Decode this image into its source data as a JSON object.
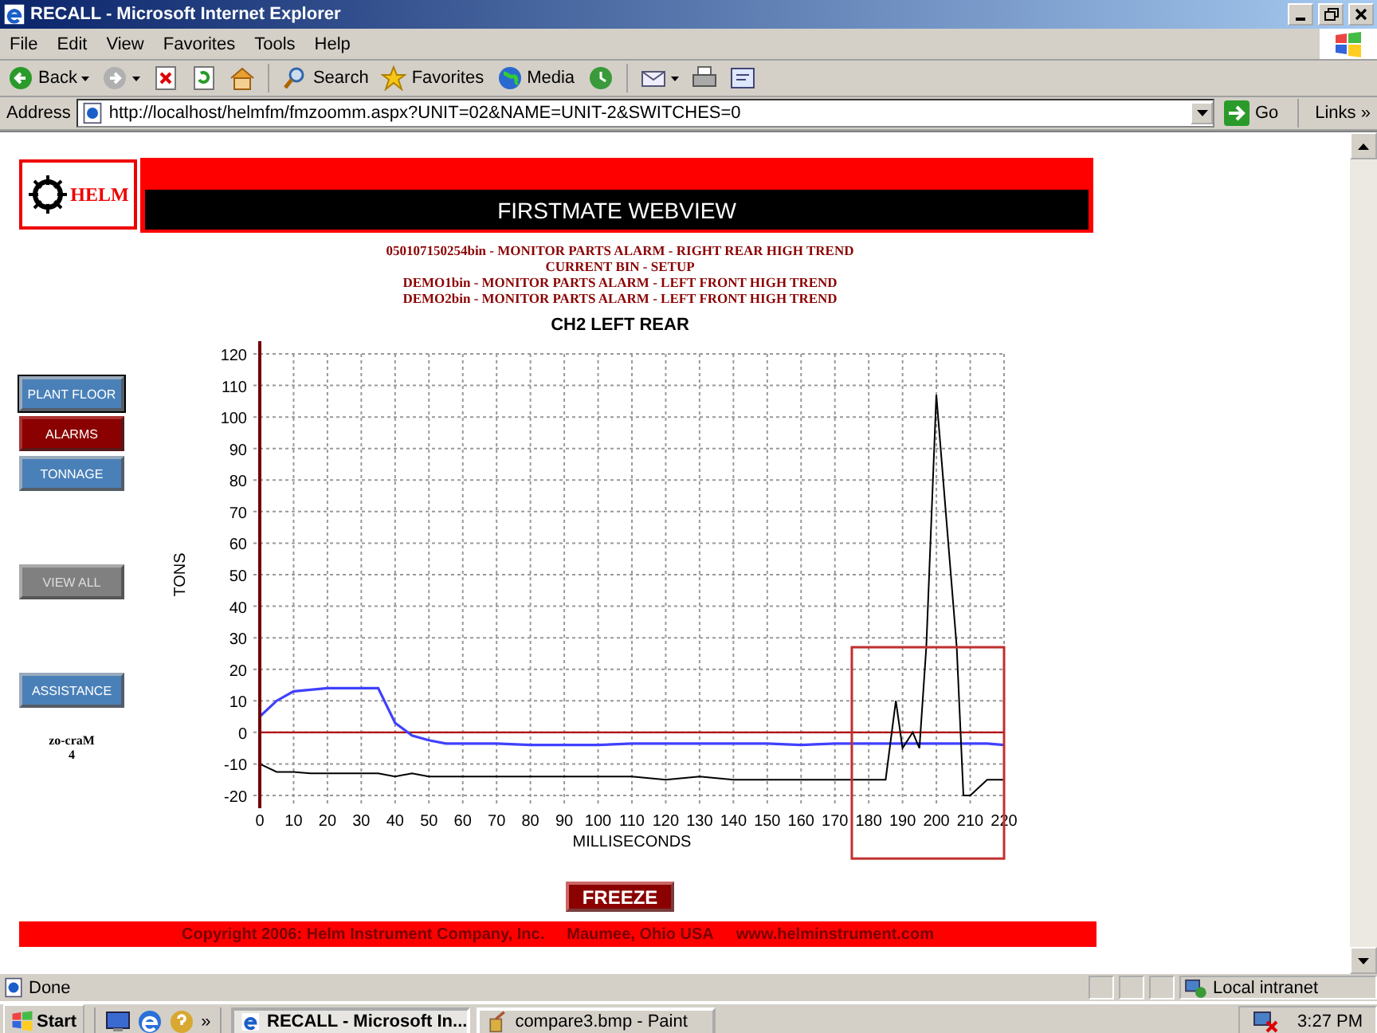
{
  "window": {
    "title": "RECALL - Microsoft Internet Explorer"
  },
  "menu": [
    "File",
    "Edit",
    "View",
    "Favorites",
    "Tools",
    "Help"
  ],
  "toolbar": [
    {
      "kind": "back",
      "label": "Back"
    },
    {
      "kind": "forward"
    },
    {
      "kind": "stop"
    },
    {
      "kind": "refresh"
    },
    {
      "kind": "home"
    },
    {
      "kind": "search",
      "label": "Search"
    },
    {
      "kind": "favorites",
      "label": "Favorites"
    },
    {
      "kind": "media",
      "label": "Media"
    },
    {
      "kind": "history"
    },
    {
      "kind": "mail"
    },
    {
      "kind": "print"
    },
    {
      "kind": "edit"
    }
  ],
  "address": {
    "label": "Address",
    "url": "http://localhost/helmfm/fmzoomm.aspx?UNIT=02&NAME=UNIT-2&SWITCHES=0",
    "go": "Go",
    "links": "Links",
    "more": "»"
  },
  "page": {
    "logo": "HELM",
    "title": "FIRSTMATE WEBVIEW",
    "alarms": [
      "050107150254bin - MONITOR PARTS ALARM - RIGHT REAR HIGH TREND",
      "CURRENT BIN - SETUP",
      "DEMO1bin - MONITOR PARTS ALARM - LEFT FRONT HIGH TREND",
      "DEMO2bin - MONITOR PARTS ALARM - LEFT FRONT HIGH TREND"
    ],
    "nav_groups": [
      [
        {
          "label": "PLANT FLOOR",
          "selected": false,
          "focused": true,
          "disabled": false
        },
        {
          "label": "ALARMS",
          "selected": true,
          "focused": false,
          "disabled": false
        },
        {
          "label": "TONNAGE",
          "selected": false,
          "focused": false,
          "disabled": false
        }
      ],
      [
        {
          "label": "VIEW ALL",
          "selected": false,
          "focused": false,
          "disabled": true
        }
      ],
      [
        {
          "label": "ASSISTANCE",
          "selected": false,
          "focused": false,
          "disabled": false
        }
      ]
    ],
    "nav_note": [
      "zo-craM",
      "4"
    ],
    "chart": {
      "chart_data": {
        "type": "line",
        "title": "CH2 LEFT REAR",
        "xlabel": "MILLISECONDS",
        "ylabel": "TONS",
        "x": [
          0,
          5,
          10,
          15,
          20,
          25,
          30,
          35,
          40,
          45,
          50,
          55,
          60,
          70,
          80,
          90,
          100,
          110,
          120,
          130,
          140,
          150,
          160,
          170,
          180,
          185,
          188,
          190,
          193,
          195,
          197,
          200,
          203,
          206,
          208,
          210,
          215,
          220
        ],
        "series": [
          {
            "color": "#4040ff",
            "values": [
              5,
              10,
              13,
              13.5,
              14,
              14,
              14,
              14,
              3,
              -1,
              -2.5,
              -3.5,
              -3.5,
              -3.5,
              -4,
              -4,
              -4,
              -3.5,
              -3.5,
              -3.5,
              -3.5,
              -3.5,
              -4,
              -3.5,
              -3.5,
              -3.5,
              -3.5,
              -3.5,
              -3.5,
              -3.5,
              -3.5,
              -3.5,
              -3.5,
              -3.5,
              -3.5,
              -3.5,
              -3.5,
              -4
            ]
          },
          {
            "color": "#000000",
            "values": [
              -10,
              -12.5,
              -12.5,
              -13,
              -13,
              -13,
              -13,
              -13,
              -14,
              -13,
              -14,
              -14,
              -14,
              -14,
              -14,
              -14,
              -14,
              -14,
              -15,
              -14,
              -15,
              -15,
              -15,
              -15,
              -15,
              -15,
              10,
              -5,
              0,
              -5,
              27,
              107,
              67,
              27,
              -20,
              -20,
              -15,
              -15
            ]
          }
        ],
        "xlim": [
          0,
          220
        ],
        "ylim": [
          -20,
          120
        ],
        "xticks": [
          0,
          10,
          20,
          30,
          40,
          50,
          60,
          70,
          80,
          90,
          100,
          110,
          120,
          130,
          140,
          150,
          160,
          170,
          180,
          190,
          200,
          210,
          220
        ],
        "yticks": [
          -20,
          -10,
          0,
          10,
          20,
          30,
          40,
          50,
          60,
          70,
          80,
          90,
          100,
          110,
          120
        ],
        "grid": true,
        "ref_lines": [
          {
            "axis": "y",
            "value": 0,
            "color": "#b00000"
          }
        ]
      },
      "selection_visible": true
    },
    "freeze": "FREEZE",
    "footer": [
      "Copyright 2006: Helm Instrument Company, Inc.",
      "Maumee, Ohio USA",
      "www.helminstrument.com"
    ]
  },
  "status_bar": {
    "text": "Done",
    "zone": "Local intranet"
  },
  "taskbar": {
    "start": "Start",
    "more": "»",
    "tasks": [
      {
        "kind": "ie",
        "label": "RECALL - Microsoft In...",
        "selected": true
      },
      {
        "kind": "paint",
        "label": "compare3.bmp - Paint",
        "selected": false
      }
    ],
    "clock": "3:27 PM"
  }
}
